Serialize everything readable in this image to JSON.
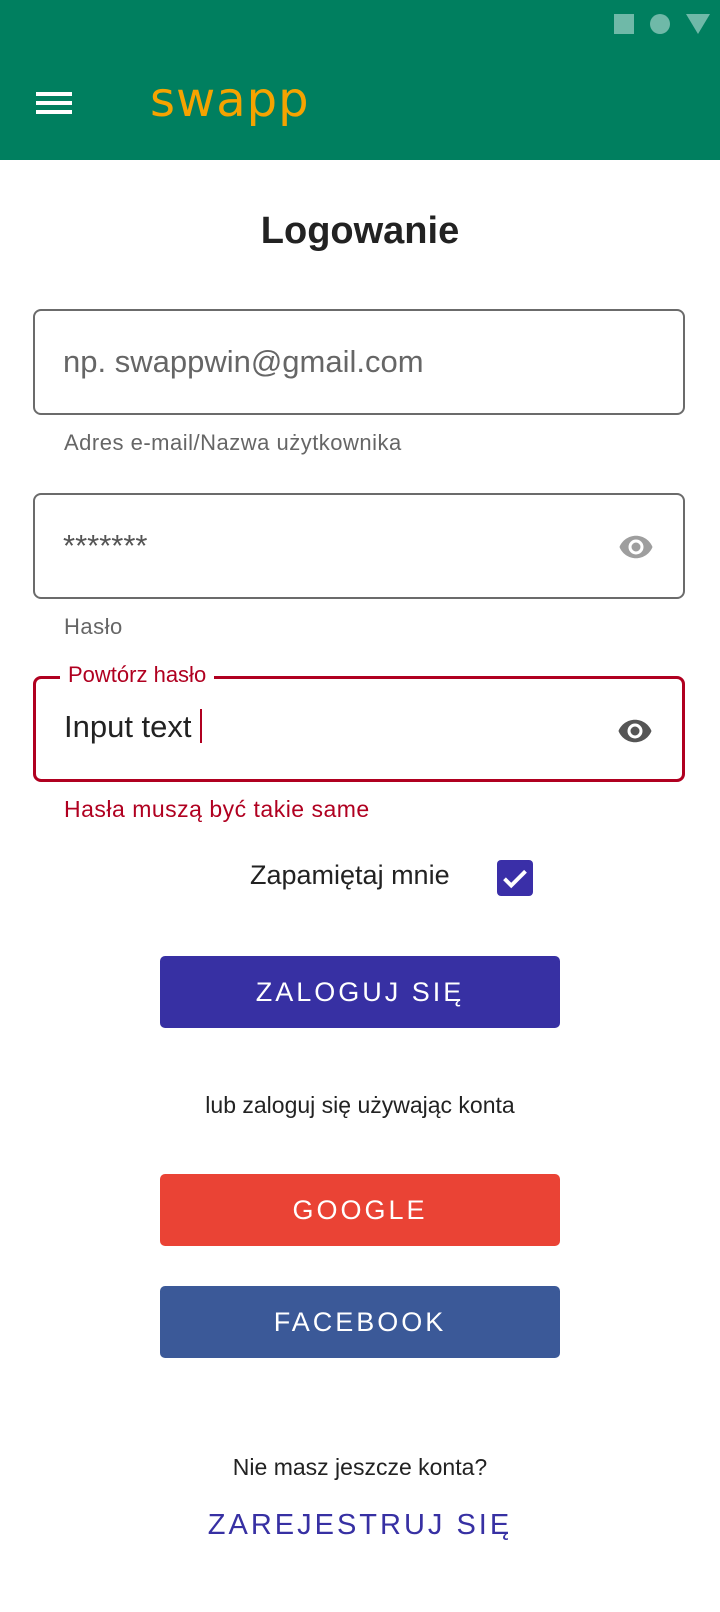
{
  "header": {
    "app_name": "swapp",
    "bg_color": "#007F5F",
    "logo_color": "#F5A300",
    "menu_icon": "hamburger-menu-icon"
  },
  "page": {
    "title": "Logowanie"
  },
  "form": {
    "email": {
      "placeholder": "np. swappwin@gmail.com",
      "value": "",
      "helper": "Adres e-mail/Nazwa użytkownika"
    },
    "password": {
      "value": "*******",
      "helper": "Hasło",
      "icon": "eye-icon"
    },
    "repeat_password": {
      "label": "Powtórz hasło",
      "value": "Input text",
      "error": "Hasła muszą być takie same",
      "icon": "eye-icon",
      "error_color": "#B00020"
    },
    "remember": {
      "label": "Zapamiętaj mnie",
      "checked": true
    }
  },
  "buttons": {
    "login": "ZALOGUJ SIĘ",
    "or_text": "lub zaloguj się używając konta",
    "google": "GOOGLE",
    "facebook": "FACEBOOK",
    "no_account": "Nie masz jeszcze konta?",
    "register": "ZAREJESTRUJ SIĘ"
  },
  "colors": {
    "primary": "#3730A3",
    "google": "#EA4335",
    "facebook": "#3B5998"
  }
}
